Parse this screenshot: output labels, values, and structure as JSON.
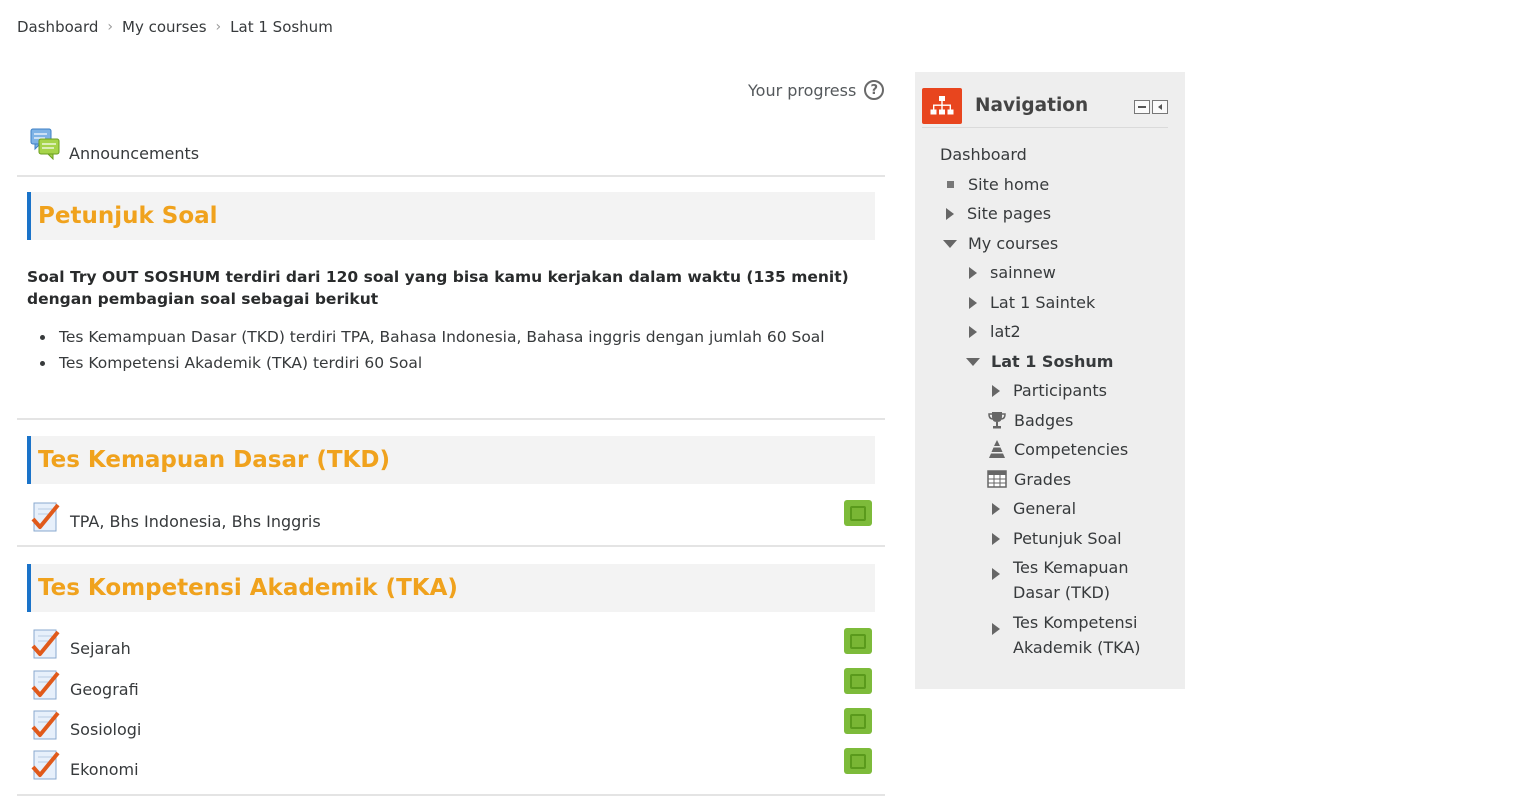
{
  "breadcrumb": {
    "items": [
      "Dashboard",
      "My courses",
      "Lat 1 Soshum"
    ]
  },
  "progress": {
    "label": "Your progress",
    "help_glyph": "?"
  },
  "announcements": {
    "label": "Announcements",
    "icon": "forum-icon"
  },
  "sections": [
    {
      "title": "Petunjuk Soal",
      "summary": "Soal Try OUT SOSHUM terdiri dari 120 soal yang bisa kamu kerjakan dalam waktu (135 menit) dengan pembagian soal sebagai berikut",
      "bullets": [
        "Tes Kemampuan Dasar (TKD) terdiri TPA, Bahasa Indonesia, Bahasa inggris dengan jumlah 60 Soal",
        "Tes Kompetensi Akademik (TKA) terdiri 60 Soal"
      ]
    },
    {
      "title": "Tes Kemapuan Dasar (TKD)",
      "activities": [
        "TPA, Bhs Indonesia, Bhs Inggris"
      ]
    },
    {
      "title": "Tes Kompetensi Akademik (TKA)",
      "activities": [
        "Sejarah",
        "Geografi",
        "Sosiologi",
        "Ekonomi"
      ]
    }
  ],
  "navigation": {
    "title": "Navigation",
    "items": [
      {
        "label": "Dashboard"
      },
      {
        "label": "Site home"
      },
      {
        "label": "Site pages"
      },
      {
        "label": "My courses"
      },
      {
        "label": "sainnew"
      },
      {
        "label": "Lat 1 Saintek"
      },
      {
        "label": "lat2"
      },
      {
        "label": "Lat 1 Soshum"
      },
      {
        "label": "Participants"
      },
      {
        "label": "Badges"
      },
      {
        "label": "Competencies"
      },
      {
        "label": "Grades"
      },
      {
        "label": "General"
      },
      {
        "label": "Petunjuk Soal"
      },
      {
        "label_1": "Tes Kemapuan",
        "label_2": "Dasar (TKD)"
      },
      {
        "label_1": "Tes Kompetensi",
        "label_2": "Akademik (TKA)"
      }
    ]
  },
  "colors": {
    "section_title": "#f0a21d",
    "section_accent": "#1a73c9",
    "completion": "#7dbb3a",
    "nav_logo": "#e8451e"
  }
}
